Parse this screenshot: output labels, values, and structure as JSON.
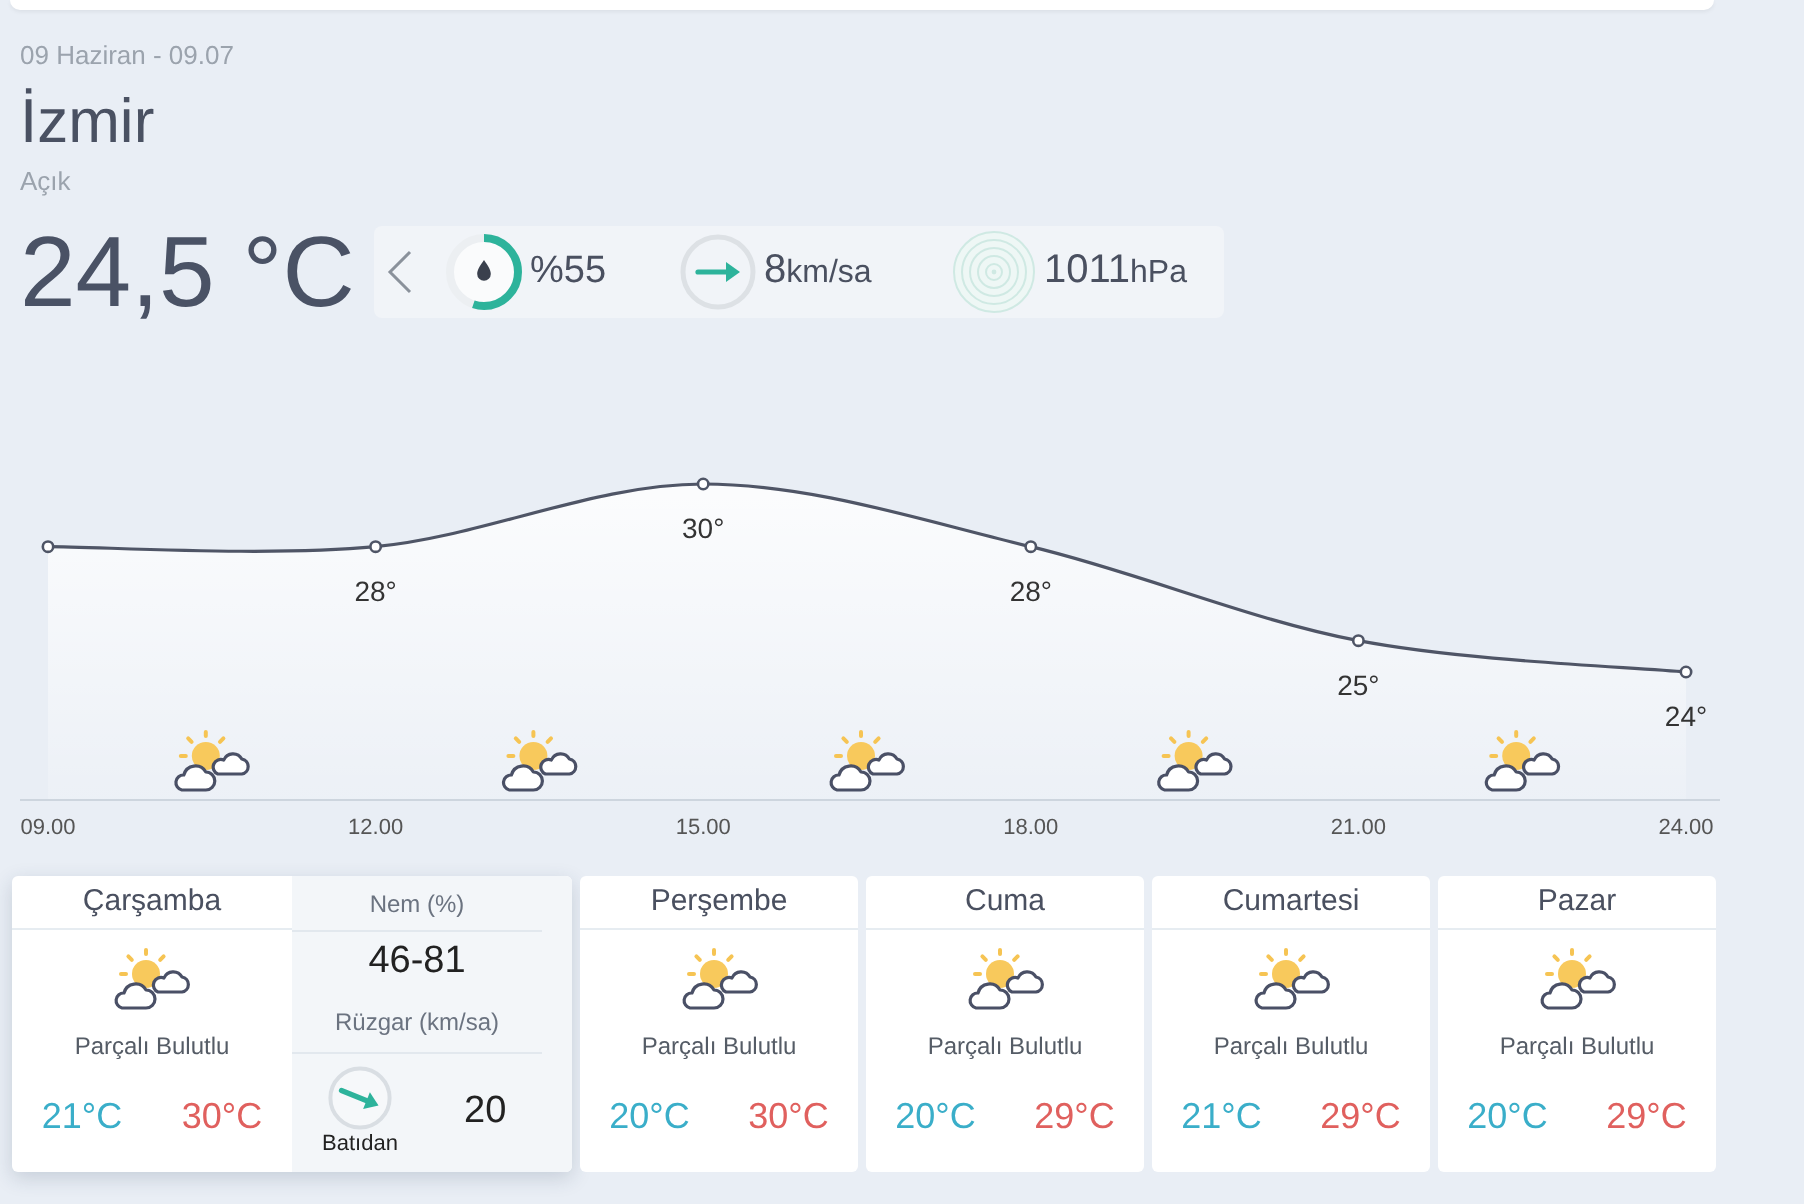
{
  "header": {
    "date": "09 Haziran - 09.07",
    "city": "İzmir",
    "condition": "Açık",
    "temperature": "24,5 °C"
  },
  "current": {
    "humidity": {
      "value": "%55",
      "level": 0.55
    },
    "wind": {
      "value": "8",
      "unit": "km/sa"
    },
    "pressure": {
      "value": "1011",
      "unit": "hPa"
    }
  },
  "chart": {
    "chart_data": {
      "type": "area",
      "marker": "o",
      "categories": [
        "09.00",
        "12.00",
        "15.00",
        "18.00",
        "21.00",
        "24.00"
      ],
      "values": [
        28,
        28,
        30,
        28,
        25,
        24
      ],
      "value_labels": [
        null,
        "28°",
        "30°",
        "28°",
        "25°",
        "24°"
      ]
    }
  },
  "days": [
    {
      "day": "Çarşamba",
      "expanded": true,
      "condition": "Parçalı Bulutlu",
      "low": "21°C",
      "high": "30°C",
      "details": {
        "humidity_label": "Nem (%)",
        "humidity": "46-81",
        "wind_label": "Rüzgar (km/sa)",
        "wind_direction": "Batıdan",
        "wind_speed": "20"
      }
    },
    {
      "day": "Perşembe",
      "expanded": false,
      "condition": "Parçalı Bulutlu",
      "low": "20°C",
      "high": "30°C"
    },
    {
      "day": "Cuma",
      "expanded": false,
      "condition": "Parçalı Bulutlu",
      "low": "20°C",
      "high": "29°C"
    },
    {
      "day": "Cumartesi",
      "expanded": false,
      "condition": "Parçalı Bulutlu",
      "low": "21°C",
      "high": "29°C"
    },
    {
      "day": "Pazar",
      "expanded": false,
      "condition": "Parçalı Bulutlu",
      "low": "20°C",
      "high": "29°C"
    }
  ]
}
